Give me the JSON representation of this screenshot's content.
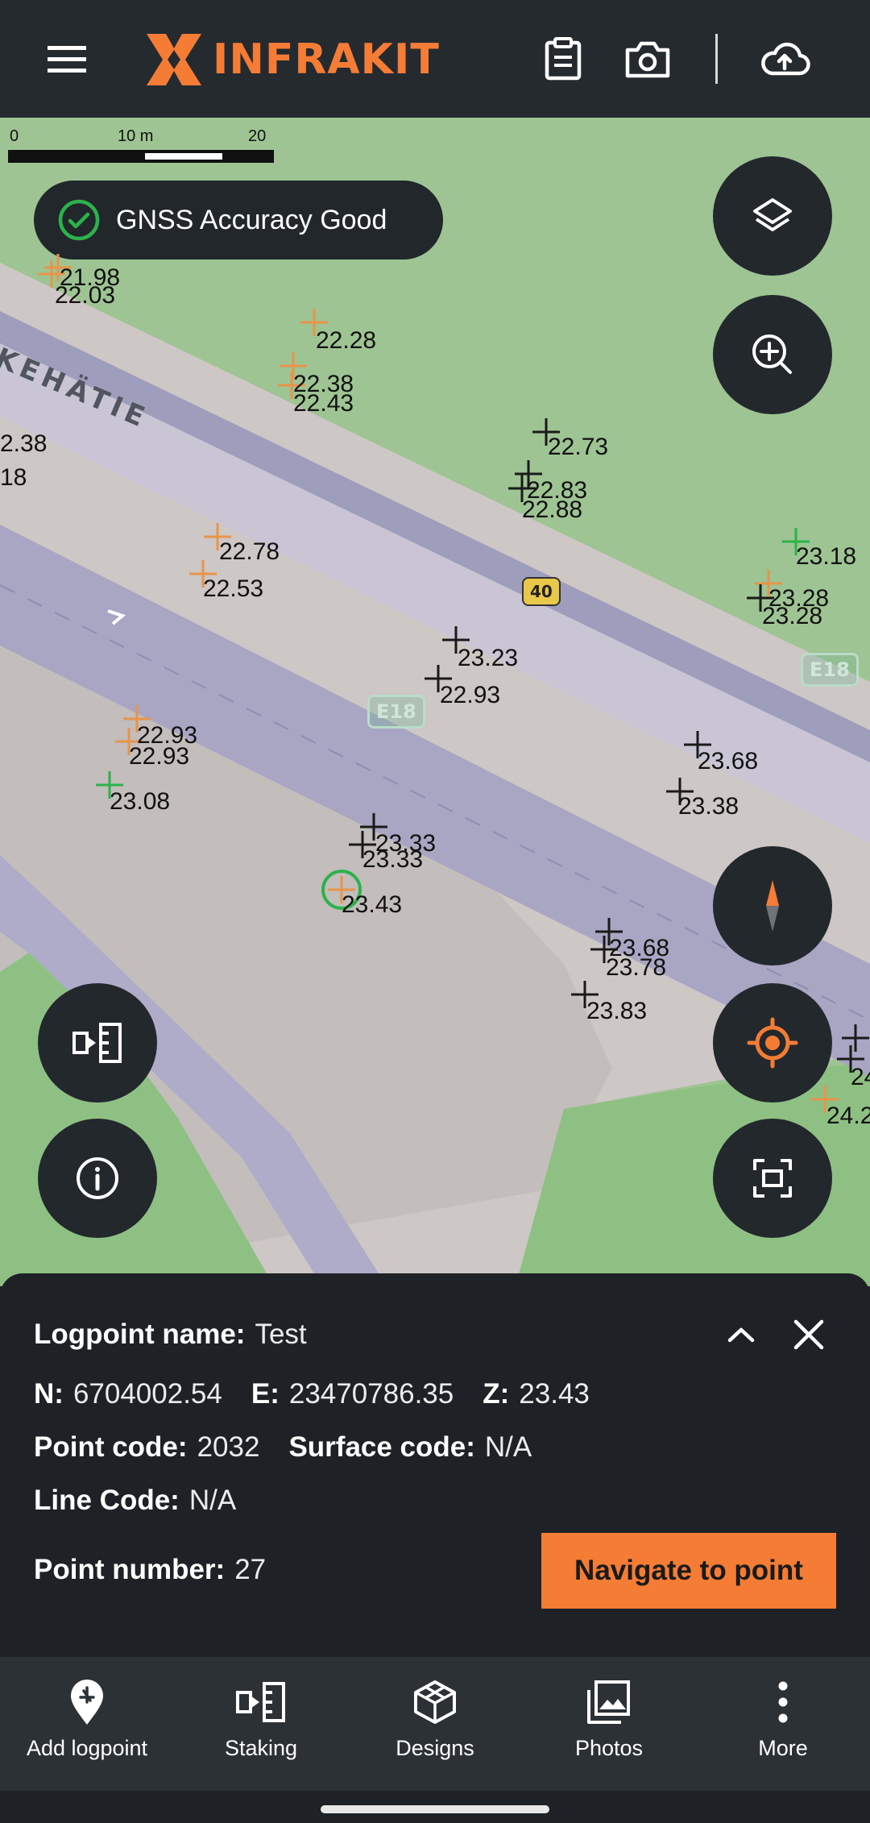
{
  "app": {
    "brand": "INFRAKIT",
    "brand_color": "#f47c35",
    "icons": [
      "menu-icon",
      "clipboard-icon",
      "camera-icon",
      "cloud-upload-icon"
    ]
  },
  "map": {
    "scale": {
      "labels": [
        "0",
        "10 m",
        "20 m"
      ]
    },
    "gnss": {
      "text": "GNSS Accuracy Good",
      "status_color": "#2bb34a"
    },
    "road_label": "KEHÄTIE",
    "shields": {
      "road_40": "40",
      "e18_a": "E18",
      "e18_b": "E18"
    },
    "points": [
      "21.98",
      "22.03",
      "22.28",
      "22.38",
      "22.43",
      "22.73",
      "22.83",
      "22.88",
      "2.38",
      "18",
      "22.78",
      "22.53",
      "23.18",
      "23.28",
      "23.28",
      "23.23",
      "22.93",
      "22.93",
      "22.93",
      "23.08",
      "23.68",
      "23.38",
      "23.33",
      "23.33",
      "23.43",
      "23.68",
      "23.78",
      "23.83",
      "24",
      "24.2"
    ],
    "marker_colors": {
      "orange": "#e8944a",
      "black": "#1a1a1a",
      "green": "#2bb34a"
    }
  },
  "logpoint": {
    "name_label": "Logpoint name:",
    "name_value": "Test",
    "n_label": "N:",
    "n_value": "6704002.54",
    "e_label": "E:",
    "e_value": "23470786.35",
    "z_label": "Z:",
    "z_value": "23.43",
    "point_code_label": "Point code:",
    "point_code_value": "2032",
    "surface_code_label": "Surface code:",
    "surface_code_value": "N/A",
    "line_code_label": "Line Code:",
    "line_code_value": "N/A",
    "point_number_label": "Point number:",
    "point_number_value": "27",
    "navigate_label": "Navigate to point"
  },
  "bottom_nav": {
    "items": [
      {
        "label": "Add logpoint",
        "icon": "add-logpoint-icon"
      },
      {
        "label": "Staking",
        "icon": "staking-icon"
      },
      {
        "label": "Designs",
        "icon": "designs-icon"
      },
      {
        "label": "Photos",
        "icon": "photos-icon"
      },
      {
        "label": "More",
        "icon": "more-icon"
      }
    ]
  }
}
